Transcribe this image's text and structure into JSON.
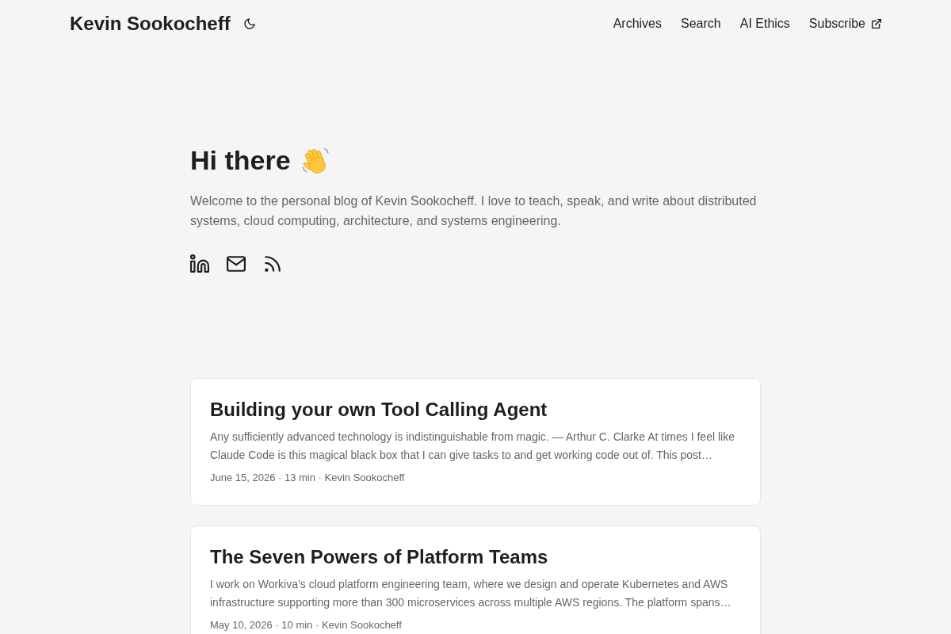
{
  "header": {
    "site_title": "Kevin Sookocheff",
    "nav": [
      {
        "label": "Archives",
        "external": false
      },
      {
        "label": "Search",
        "external": false
      },
      {
        "label": "AI Ethics",
        "external": false
      },
      {
        "label": "Subscribe",
        "external": true
      }
    ]
  },
  "hero": {
    "heading": "Hi there",
    "intro": "Welcome to the personal blog of Kevin Sookocheff. I love to teach, speak, and write about distributed systems, cloud computing, architecture, and systems engineering.",
    "social_links": [
      {
        "kind": "linkedin"
      },
      {
        "kind": "email"
      },
      {
        "kind": "rss"
      }
    ]
  },
  "posts": [
    {
      "title": "Building your own Tool Calling Agent",
      "summary": "Any sufficiently advanced technology is indistinguishable from magic. — Arthur C. Clarke At times I feel like Claude Code is this magical black box that I can give tasks to and get working code out of. This post…",
      "meta": "June 15, 2026 · 13 min · Kevin Sookocheff"
    },
    {
      "title": "The Seven Powers of Platform Teams",
      "summary": "I work on Workiva’s cloud platform engineering team, where we design and operate Kubernetes and AWS infrastructure supporting more than 300 microservices across multiple AWS regions. The platform spans…",
      "meta": "May 10, 2026 · 10 min · Kevin Sookocheff"
    }
  ]
}
